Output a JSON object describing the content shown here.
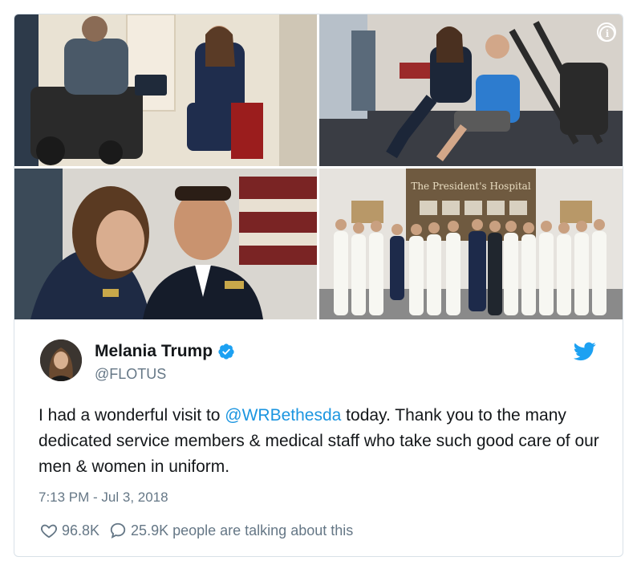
{
  "tweet": {
    "display_name": "Melania Trump",
    "handle": "@FLOTUS",
    "text_before": "I had a wonderful visit to ",
    "mention": "@WRBethesda",
    "text_after": " today.  Thank you to the many dedicated service members & medical staff who take such good care of our men & women in uniform.",
    "timestamp": "7:13 PM - Jul 3, 2018",
    "likes": "96.8K",
    "replies_text": "25.9K people are talking about this"
  },
  "media": {
    "sign_text": "The President's Hospital"
  },
  "icons": {
    "info": "info-icon",
    "verified": "verified-badge-icon",
    "bird": "twitter-bird-icon",
    "like": "heart-icon",
    "reply": "speech-bubble-icon"
  },
  "colors": {
    "accent": "#1da1f2",
    "link": "#1b95e0",
    "muted": "#657786",
    "text": "#14171a",
    "border": "#d9e1e8"
  }
}
